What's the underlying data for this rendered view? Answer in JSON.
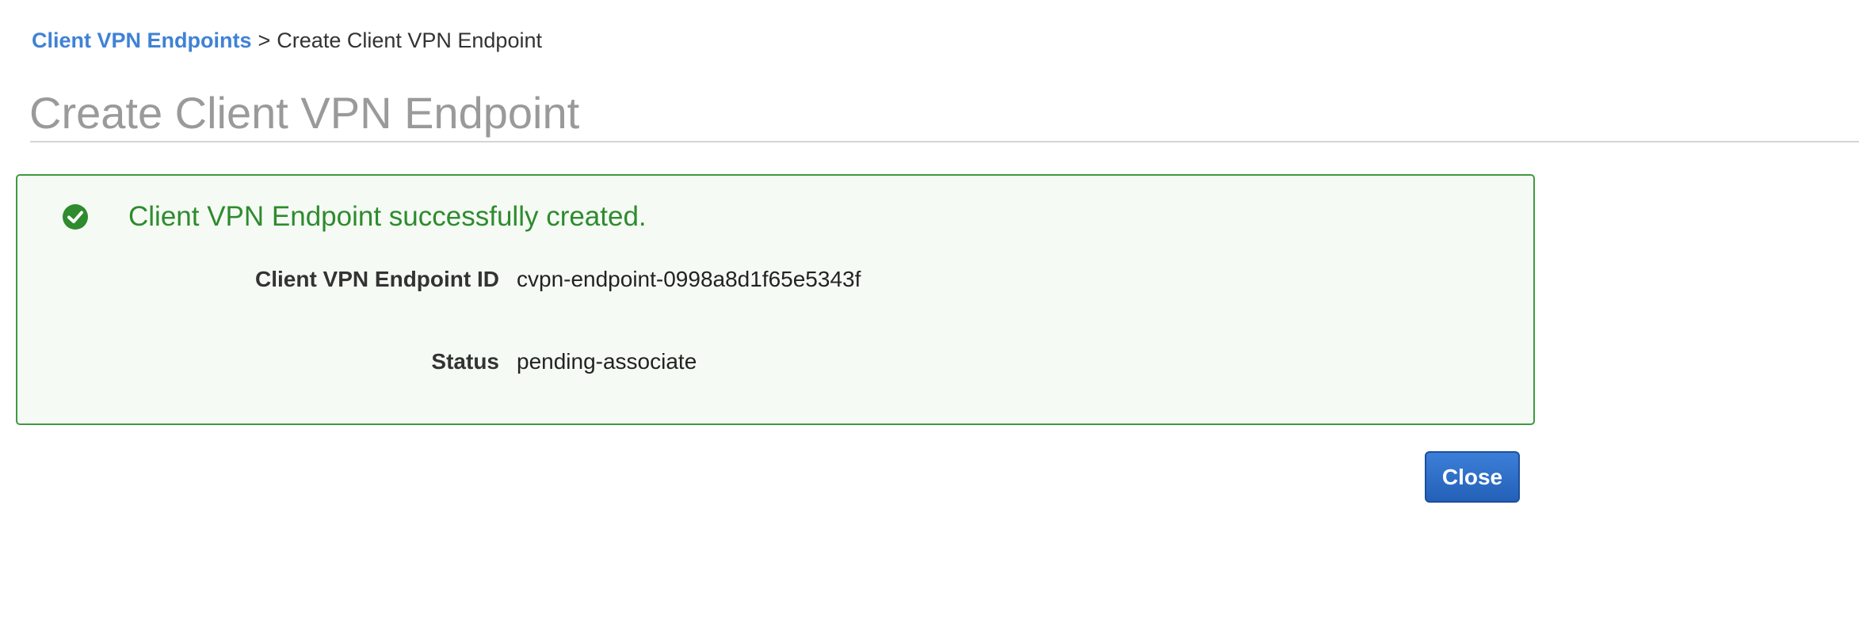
{
  "breadcrumb": {
    "parent_label": "Client VPN Endpoints",
    "separator": ">",
    "current_label": "Create Client VPN Endpoint"
  },
  "page": {
    "title": "Create Client VPN Endpoint"
  },
  "success_panel": {
    "icon": "check-circle-icon",
    "message": "Client VPN Endpoint successfully created.",
    "details": [
      {
        "label": "Client VPN Endpoint ID",
        "value": "cvpn-endpoint-0998a8d1f65e5343f"
      },
      {
        "label": "Status",
        "value": "pending-associate"
      }
    ]
  },
  "actions": {
    "close_label": "Close"
  },
  "colors": {
    "link": "#3f82d5",
    "title": "#9a9a9a",
    "success_border": "#3d9a3f",
    "success_text": "#2e8b2e",
    "success_bg": "#f5fbf4",
    "primary_button": "#2e6fc8"
  }
}
